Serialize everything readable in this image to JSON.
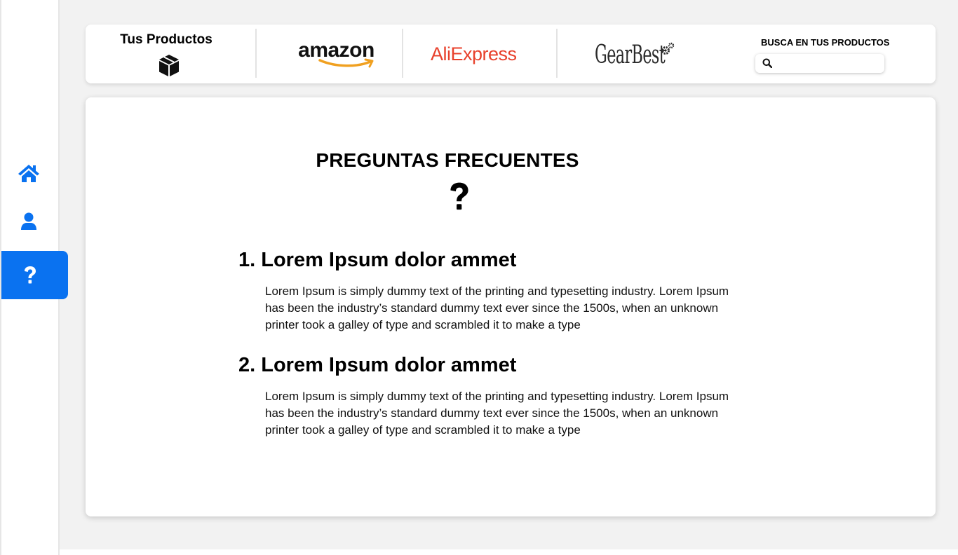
{
  "sidebar": {
    "items": [
      {
        "icon": "home-icon",
        "active": false
      },
      {
        "icon": "user-icon",
        "active": false
      },
      {
        "icon": "question-icon",
        "active": true
      }
    ],
    "accent_color": "#0a72f0"
  },
  "topbar": {
    "products_title": "Tus Productos",
    "products_icon": "box-icon",
    "stores": [
      {
        "name": "amazon",
        "color": "#111111",
        "accent": "#f0a020"
      },
      {
        "name": "AliExpress",
        "color": "#e8412c"
      },
      {
        "name": "GearBest",
        "color": "#2b2b2b"
      }
    ],
    "search": {
      "label": "BUSCA EN TUS PRODUCTOS",
      "value": "",
      "placeholder": ""
    }
  },
  "faq": {
    "title": "PREGUNTAS FRECUENTES",
    "icon": "question-icon",
    "items": [
      {
        "heading": "1. Lorem Ipsum dolor ammet",
        "body": "Lorem Ipsum is simply dummy text of the printing and typesetting industry. Lorem Ipsum has been the industry’s standard dummy text ever since the 1500s, when an unknown printer took a galley of type and scrambled it to make a type"
      },
      {
        "heading": "2. Lorem Ipsum dolor ammet",
        "body": "Lorem Ipsum is simply dummy text of the printing and typesetting industry. Lorem Ipsum has been the industry’s standard dummy text ever since the 1500s, when an unknown printer took a galley of type and scrambled it to make a type"
      }
    ]
  }
}
